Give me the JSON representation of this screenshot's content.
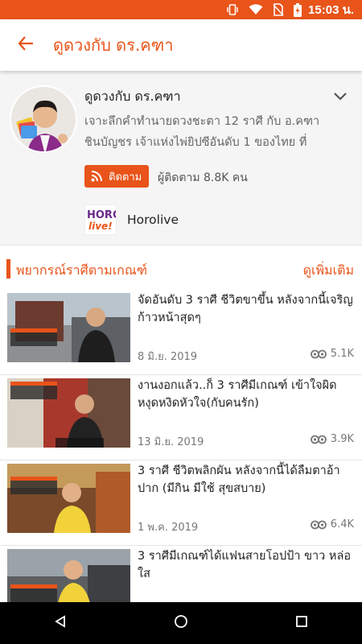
{
  "status_bar": {
    "time": "15:03 น.",
    "icons": [
      "vibrate-icon",
      "wifi-icon",
      "no-sim-icon",
      "battery-charging-icon"
    ]
  },
  "app_bar": {
    "back_icon": "arrow-left-icon",
    "title": "ดูดวงกับ ดร.คฑา"
  },
  "channel": {
    "name": "ดูดวงกับ ดร.คฑา",
    "description": "เจาะลึกคำทำนายดวงชะตา 12 ราศี กับ อ.คฑา ชินบัญชร เจ้าแห่งไพ่ยิปซีอันดับ 1 ของไทย ที่",
    "follow_label": "ติดตาม",
    "followers_text": "ผู้ติดตาม 8.8K คน",
    "brand_logo_text": "HORO live!",
    "brand_name": "Horolive"
  },
  "section": {
    "title": "พยากรณ์ราศีตามเกณฑ์",
    "more_label": "ดูเพิ่มเติม"
  },
  "videos": [
    {
      "title": "จัดอันดับ 3 ราศี ชีวิตขาขึ้น หลังจากนี้เจริญก้าวหน้าสุดๆ",
      "date": "8 มิ.ย. 2019",
      "views": "5.1K"
    },
    {
      "title": "งานงอกแล้ว..ก็ 3 ราศีมีเกณฑ์ เข้าใจผิด หงุดหงิดหัวใจ(กับคนรัก)",
      "date": "13 มิ.ย. 2019",
      "views": "3.9K"
    },
    {
      "title": "3 ราศี ชีวิตพลิกผัน หลังจากนี้ได้ลืมตาอ้าปาก (มีกิน มีใช้ สุขสบาย)",
      "date": "1 พ.ค. 2019",
      "views": "6.4K"
    },
    {
      "title": "3 ราศีมีเกณฑ์ได้แฟนสายโอปป้า ขาว หล่อใส",
      "date": "",
      "views": ""
    }
  ],
  "colors": {
    "accent": "#e8541a",
    "nav_bar": "#000000"
  },
  "nav_icons": [
    "back-triangle-icon",
    "home-circle-icon",
    "recents-square-icon"
  ]
}
